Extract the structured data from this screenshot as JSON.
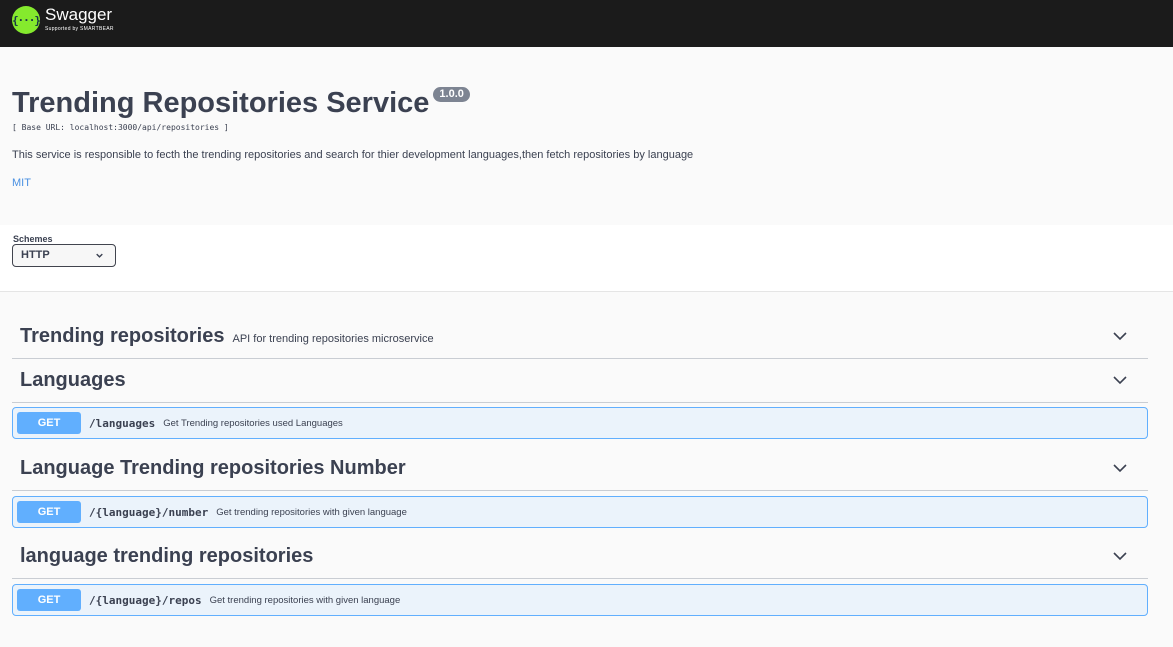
{
  "topbar": {
    "logo_glyph": "{···}",
    "logo_title": "Swagger",
    "logo_subtitle": "Supported by SMARTBEAR"
  },
  "info": {
    "title": "Trending Repositories Service",
    "version": "1.0.0",
    "base_url": "[ Base URL: localhost:3000/api/repositories ]",
    "description": "This service is responsible to fecth the trending repositories and search for thier development languages,then fetch repositories by language",
    "license": "MIT"
  },
  "schemes": {
    "label": "Schemes",
    "selected": "HTTP"
  },
  "tags": [
    {
      "name": "Trending repositories",
      "description": "API for trending repositories microservice"
    },
    {
      "name": "Languages",
      "description": ""
    },
    {
      "name": "Language Trending repositories Number",
      "description": ""
    },
    {
      "name": "language trending repositories",
      "description": ""
    }
  ],
  "operations": [
    {
      "method": "GET",
      "path": "/languages",
      "summary": "Get Trending repositories used Languages"
    },
    {
      "method": "GET",
      "path": "/{language}/number",
      "summary": "Get trending repositories with given language"
    },
    {
      "method": "GET",
      "path": "/{language}/repos",
      "summary": "Get trending repositories with given language"
    }
  ],
  "colors": {
    "topbar": "#1b1b1b",
    "logo_green": "#85ea2d",
    "get_accent": "#61affe",
    "get_bg": "#ebf3fb",
    "link": "#4990e2"
  },
  "icons": {
    "expand": "chevron-down-icon",
    "select": "chevron-down-icon"
  }
}
